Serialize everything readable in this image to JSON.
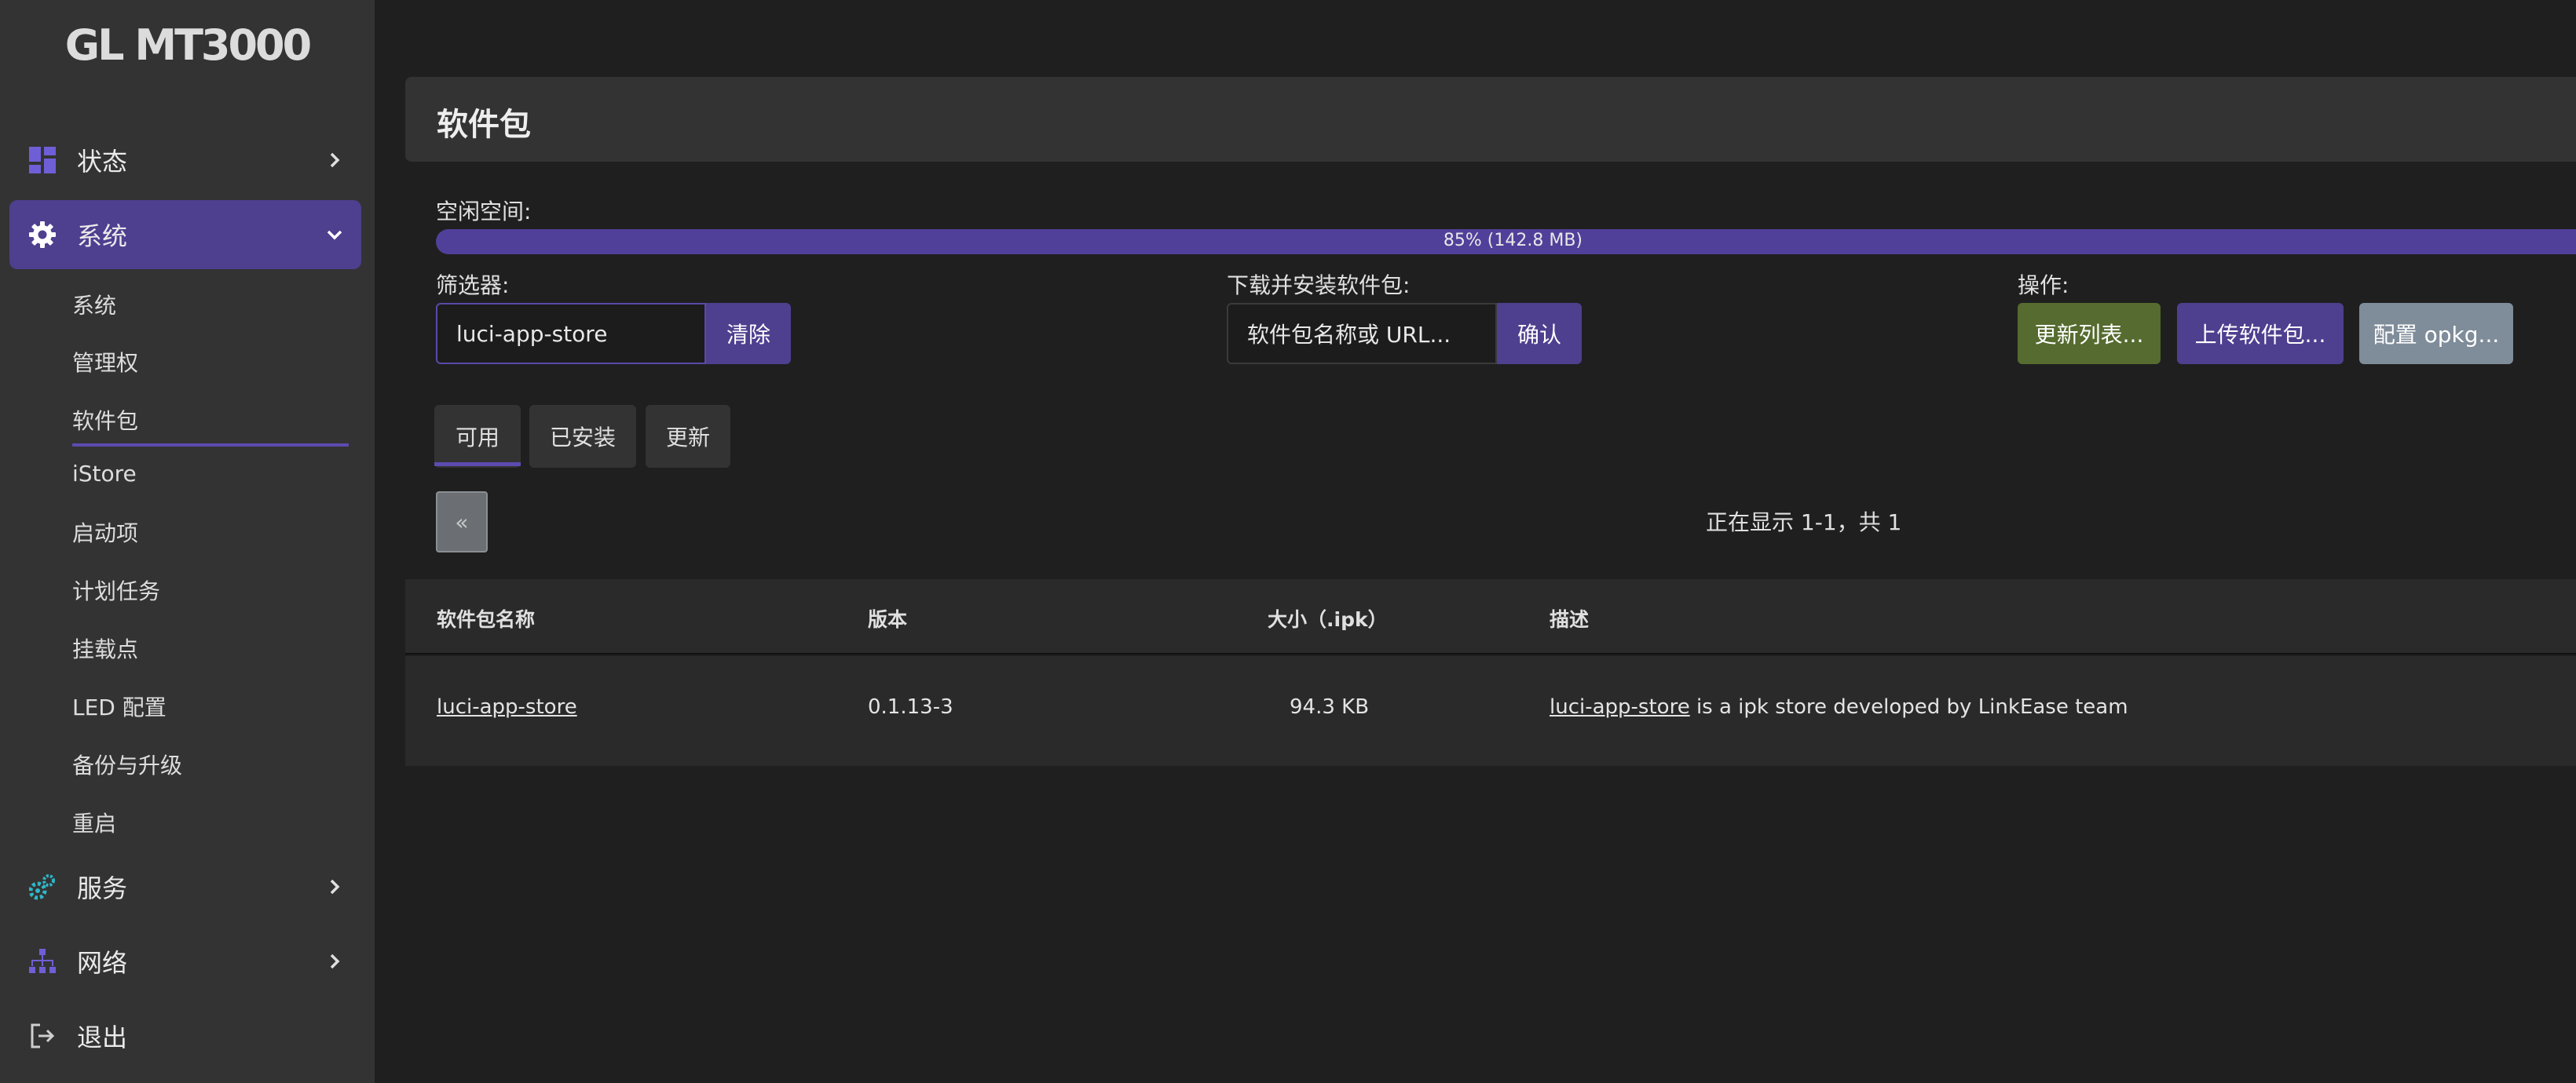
{
  "sidebar": {
    "logo": "GL MT3000",
    "menu": [
      {
        "label": "状态",
        "icon": "dashboard-icon"
      },
      {
        "label": "系统",
        "icon": "gear-icon"
      },
      {
        "label": "服务",
        "icon": "gears-icon"
      },
      {
        "label": "网络",
        "icon": "network-icon"
      },
      {
        "label": "退出",
        "icon": "logout-icon"
      }
    ],
    "submenu": [
      "系统",
      "管理权",
      "软件包",
      "iStore",
      "启动项",
      "计划任务",
      "挂载点",
      "LED 配置",
      "备份与升级",
      "重启"
    ]
  },
  "page": {
    "title": "软件包",
    "free_space_label": "空闲空间:",
    "free_space_text": "85% (142.8 MB)",
    "free_space_percent": 85,
    "filter_label": "筛选器:",
    "filter_value": "luci-app-store",
    "clear_button": "清除",
    "download_label": "下载并安装软件包:",
    "download_placeholder": "软件包名称或 URL...",
    "confirm_button": "确认",
    "actions_label": "操作:",
    "update_lists_button": "更新列表...",
    "upload_button": "上传软件包...",
    "configure_button": "配置 opkg..."
  },
  "tabs": [
    "可用",
    "已安装",
    "更新"
  ],
  "pager": {
    "prev": "«",
    "status": "正在显示 1-1，共 1"
  },
  "table": {
    "headers": [
      "软件包名称",
      "版本",
      "大小（.ipk）",
      "描述"
    ],
    "rows": [
      {
        "name": "luci-app-store",
        "version": "0.1.13-3",
        "size": "94.3 KB",
        "desc_link": "luci-app-store",
        "desc_rest": " is a ipk store developed by LinkEase team"
      }
    ]
  },
  "colors": {
    "accent": "#4e3f8f",
    "sidebar_bg": "#333333",
    "body_bg": "#1f1f1f",
    "green_button": "#556b2f",
    "gray_button": "#7f8c99",
    "dashboard_icon": "#6f5fd6",
    "services_icon": "#2fb6c9"
  }
}
